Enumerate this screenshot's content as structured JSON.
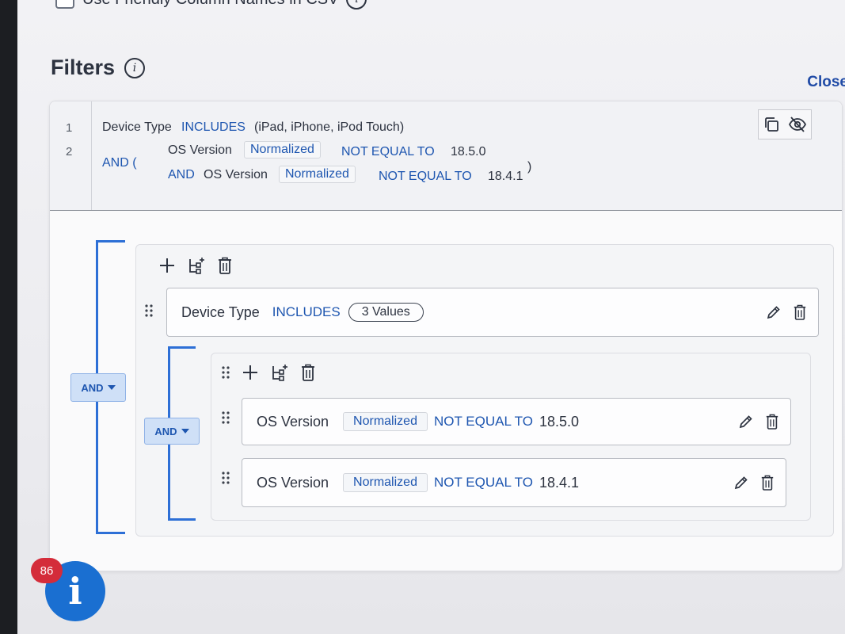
{
  "top_option": {
    "label": "Use Friendly Column Names in CSV"
  },
  "filters": {
    "title": "Filters",
    "info": "i",
    "close_label": "Close"
  },
  "summary": {
    "line_numbers": [
      "1",
      "2"
    ],
    "line1": {
      "field": "Device Type",
      "operator": "INCLUDES",
      "values": "(iPad, iPhone, iPod Touch)"
    },
    "line2": {
      "prefix": "AND (",
      "suffix": ")",
      "row1": {
        "field": "OS Version",
        "transform": "Normalized",
        "operator": "NOT EQUAL TO",
        "value": "18.5.0"
      },
      "row2": {
        "connector": "AND",
        "field": "OS Version",
        "transform": "Normalized",
        "operator": "NOT EQUAL TO",
        "value": "18.4.1"
      }
    }
  },
  "builder": {
    "outer_combinator": "AND",
    "inner_combinator": "AND",
    "rule1": {
      "field": "Device Type",
      "operator": "INCLUDES",
      "values_pill": "3 Values"
    },
    "rule2": {
      "field": "OS Version",
      "transform": "Normalized",
      "operator": "NOT EQUAL TO",
      "value": "18.5.0"
    },
    "rule3": {
      "field": "OS Version",
      "transform": "Normalized",
      "operator": "NOT EQUAL TO",
      "value": "18.4.1"
    }
  },
  "help_fab": {
    "icon": "i",
    "badge": "86"
  },
  "colors": {
    "accent": "#1e56b0",
    "bracket": "#2d6fd6",
    "badge": "#d42c3a",
    "fab": "#1a6fd1"
  }
}
